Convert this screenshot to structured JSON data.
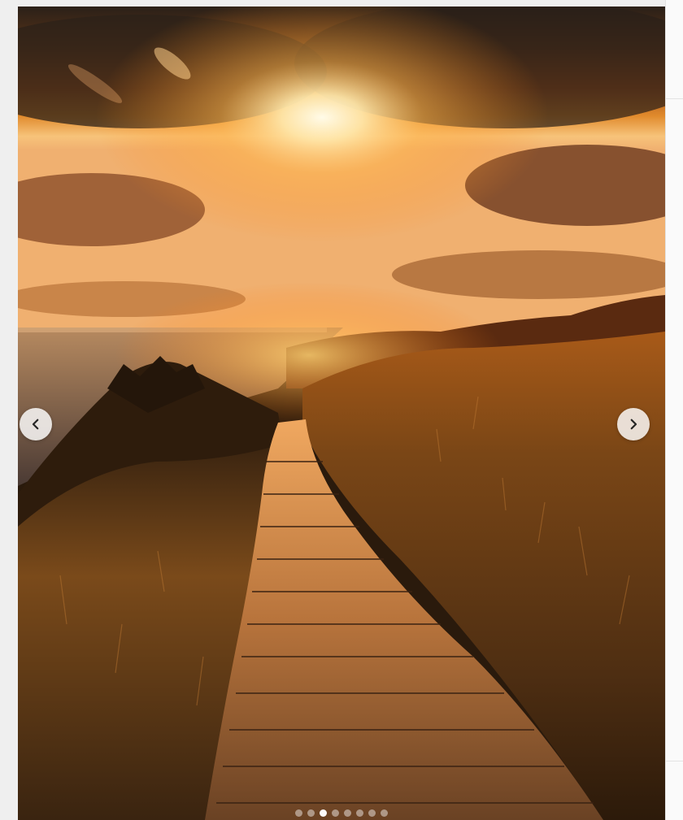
{
  "post": {
    "image_description_icon": "photo",
    "carousel": {
      "prev_icon": "chevron-left-icon",
      "next_icon": "chevron-right-icon",
      "total_slides": 8,
      "active_slide": 3
    }
  },
  "colors": {
    "page_background": "#efefef",
    "nav_button_bg": "#ffffff",
    "dot_inactive": "#b9b9b9",
    "dot_active": "#ffffff"
  }
}
